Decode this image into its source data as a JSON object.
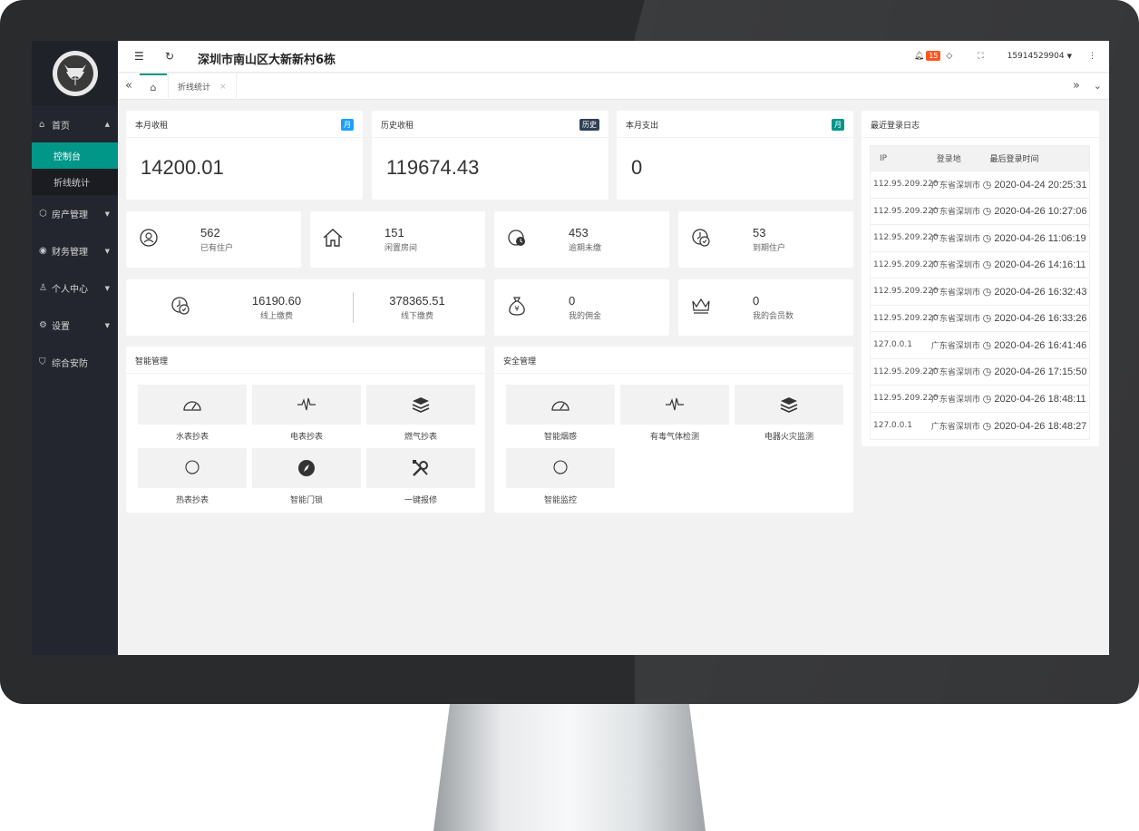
{
  "header": {
    "title": "深圳市南山区大新新村6栋",
    "notification_count": "15",
    "username": "15914529904"
  },
  "sidebar": {
    "items": [
      {
        "label": "首页"
      },
      {
        "label": "房产管理"
      },
      {
        "label": "财务管理"
      },
      {
        "label": "个人中心"
      },
      {
        "label": "设置"
      },
      {
        "label": "综合安防"
      }
    ],
    "sub_items": [
      {
        "label": "控制台"
      },
      {
        "label": "折线统计"
      }
    ]
  },
  "tabs": {
    "items": [
      {
        "label": "折线统计"
      }
    ]
  },
  "summary_cards": [
    {
      "title": "本月收租",
      "tag": "月",
      "tag_color": "#1e9fff",
      "value": "14200.01"
    },
    {
      "title": "历史收租",
      "tag": "历史",
      "tag_color": "#2f4056",
      "value": "119674.43"
    },
    {
      "title": "本月支出",
      "tag": "月",
      "tag_color": "#009688",
      "value": "0"
    }
  ],
  "stats_row1": [
    {
      "value": "562",
      "label": "已有住户",
      "icon": "user-refresh-icon"
    },
    {
      "value": "151",
      "label": "闲置房间",
      "icon": "home-icon"
    },
    {
      "value": "453",
      "label": "逾期未缴",
      "icon": "overdue-clock-icon"
    },
    {
      "value": "53",
      "label": "到期住户",
      "icon": "expired-clock-icon"
    }
  ],
  "stats_row2": {
    "online": {
      "value": "16190.60",
      "label": "线上缴费"
    },
    "offline": {
      "value": "378365.51",
      "label": "线下缴费"
    },
    "commission": {
      "value": "0",
      "label": "我的佣金"
    },
    "members": {
      "value": "0",
      "label": "我的会员数"
    }
  },
  "smart_management": {
    "title": "智能管理",
    "tiles": [
      {
        "label": "水表抄表",
        "icon": "gauge-icon"
      },
      {
        "label": "电表抄表",
        "icon": "pulse-icon"
      },
      {
        "label": "燃气抄表",
        "icon": "layers-icon"
      },
      {
        "label": "热表抄表",
        "icon": "bulb-icon"
      },
      {
        "label": "智能门锁",
        "icon": "compass-icon"
      },
      {
        "label": "一键报修",
        "icon": "tools-icon"
      }
    ]
  },
  "security_management": {
    "title": "安全管理",
    "tiles": [
      {
        "label": "智能烟感",
        "icon": "gauge-icon"
      },
      {
        "label": "有毒气体检测",
        "icon": "pulse-icon"
      },
      {
        "label": "电器火灾监测",
        "icon": "layers-icon"
      },
      {
        "label": "智能监控",
        "icon": "bulb-icon"
      }
    ]
  },
  "login_log": {
    "title": "最近登录日志",
    "columns": [
      "IP",
      "登录地",
      "最后登录时间"
    ],
    "rows": [
      {
        "ip": "112.95.209.220",
        "loc": "广东省深圳市",
        "time": "2020-04-24 20:25:31"
      },
      {
        "ip": "112.95.209.220",
        "loc": "广东省深圳市",
        "time": "2020-04-26 10:27:06"
      },
      {
        "ip": "112.95.209.220",
        "loc": "广东省深圳市",
        "time": "2020-04-26 11:06:19"
      },
      {
        "ip": "112.95.209.220",
        "loc": "广东省深圳市",
        "time": "2020-04-26 14:16:11"
      },
      {
        "ip": "112.95.209.220",
        "loc": "广东省深圳市",
        "time": "2020-04-26 16:32:43"
      },
      {
        "ip": "112.95.209.220",
        "loc": "广东省深圳市",
        "time": "2020-04-26 16:33:26"
      },
      {
        "ip": "127.0.0.1",
        "loc": "广东省深圳市",
        "time": "2020-04-26 16:41:46"
      },
      {
        "ip": "112.95.209.220",
        "loc": "广东省深圳市",
        "time": "2020-04-26 17:15:50"
      },
      {
        "ip": "112.95.209.220",
        "loc": "广东省深圳市",
        "time": "2020-04-26 18:48:11"
      },
      {
        "ip": "127.0.0.1",
        "loc": "广东省深圳市",
        "time": "2020-04-26 18:48:27"
      }
    ]
  },
  "colors": {
    "accent": "#009688",
    "sidebar": "#23262e",
    "badge": "#ff5722"
  }
}
